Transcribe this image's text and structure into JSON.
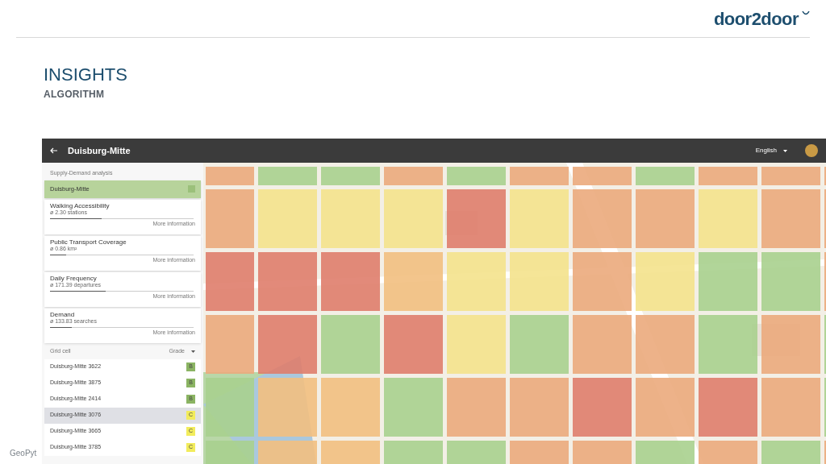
{
  "slide": {
    "logo": "door2door",
    "title": "INSIGHTS",
    "subtitle": "ALGORITHM",
    "footer": "GeoPyt"
  },
  "app": {
    "title": "Duisburg-Mitte",
    "language": "English"
  },
  "sidebar": {
    "section_label": "Supply-Demand analysis",
    "area": {
      "name": "Duisburg-Mitte",
      "selected": true
    },
    "metrics": [
      {
        "title": "Walking Accessibility",
        "value": "ø 2.30 stations",
        "level": 0.36,
        "link": "More information"
      },
      {
        "title": "Public Transport Coverage",
        "value": "ø 0.86 km²",
        "level": 0.11,
        "link": "More information"
      },
      {
        "title": "Daily Frequency",
        "value": "ø 171.39 departures",
        "level": 0.39,
        "link": "More information"
      },
      {
        "title": "Demand",
        "value": "ø 133.83 searches",
        "level": 0.15,
        "link": "More information"
      }
    ],
    "grid_list": {
      "columns": [
        "Grid cell",
        "Grade"
      ],
      "rows": [
        {
          "name": "Duisburg-Mitte 3622",
          "grade": "B",
          "color": "#8bb463",
          "selected": false
        },
        {
          "name": "Duisburg-Mitte 3875",
          "grade": "B",
          "color": "#8bb463",
          "selected": false
        },
        {
          "name": "Duisburg-Mitte 2414",
          "grade": "B",
          "color": "#8bb463",
          "selected": false
        },
        {
          "name": "Duisburg-Mitte 3076",
          "grade": "C",
          "color": "#f2ec5c",
          "selected": true
        },
        {
          "name": "Duisburg-Mitte 3665",
          "grade": "C",
          "color": "#f2ec5c",
          "selected": false
        },
        {
          "name": "Duisburg-Mitte 3785",
          "grade": "C",
          "color": "#f2ec5c",
          "selected": false
        }
      ]
    }
  },
  "heatmap": {
    "rows": [
      {
        "cells": [
          {
            "color": "#ebaa7c"
          },
          {
            "color": "#a9d08e"
          },
          {
            "color": "#a9d08e"
          },
          {
            "color": "#ebaa7c"
          },
          {
            "color": "#a9d08e"
          },
          {
            "color": "#ebaa7c"
          },
          {
            "color": "#ebaa7c"
          },
          {
            "color": "#a9d08e"
          },
          {
            "color": "#ebaa7c"
          },
          {
            "color": "#ebaa7c"
          },
          {
            "color": "#ebaa7c"
          }
        ]
      },
      {
        "cells": [
          {
            "color": "#ebaa7c"
          },
          {
            "color": "#f4e28c"
          },
          {
            "color": "#f4e28c"
          },
          {
            "color": "#f4e28c"
          },
          {
            "color": "#df7d6c"
          },
          {
            "color": "#f4e28c"
          },
          {
            "color": "#ebaa7c"
          },
          {
            "color": "#ebaa7c"
          },
          {
            "color": "#f4e28c"
          },
          {
            "color": "#ebaa7c"
          },
          {
            "color": "#ebaa7c"
          }
        ]
      },
      {
        "cells": [
          {
            "color": "#df7d6c"
          },
          {
            "color": "#df7d6c"
          },
          {
            "color": "#df7d6c"
          },
          {
            "color": "#f2bf80"
          },
          {
            "color": "#f4e28c"
          },
          {
            "color": "#f4e28c"
          },
          {
            "color": "#ebaa7c"
          },
          {
            "color": "#f4e28c"
          },
          {
            "color": "#a9d08e"
          },
          {
            "color": "#a9d08e"
          },
          {
            "color": "#ebaa7c"
          }
        ]
      },
      {
        "cells": [
          {
            "color": "#ebaa7c"
          },
          {
            "color": "#df7d6c"
          },
          {
            "color": "#a9d08e"
          },
          {
            "color": "#df7d6c"
          },
          {
            "color": "#f4e28c"
          },
          {
            "color": "#a9d08e"
          },
          {
            "color": "#ebaa7c"
          },
          {
            "color": "#ebaa7c"
          },
          {
            "color": "#a9d08e"
          },
          {
            "color": "#ebaa7c"
          },
          {
            "color": "#a9d08e"
          }
        ]
      },
      {
        "cells": [
          {
            "color": "#a9d08e"
          },
          {
            "color": "#f2bf80"
          },
          {
            "color": "#f2bf80"
          },
          {
            "color": "#a9d08e"
          },
          {
            "color": "#ebaa7c"
          },
          {
            "color": "#ebaa7c"
          },
          {
            "color": "#df7d6c"
          },
          {
            "color": "#ebaa7c"
          },
          {
            "color": "#df7d6c"
          },
          {
            "color": "#ebaa7c"
          },
          {
            "color": "#a9d08e"
          }
        ]
      },
      {
        "cells": [
          {
            "color": "#a9d08e"
          },
          {
            "color": "#f2bf80"
          },
          {
            "color": "#f2bf80"
          },
          {
            "color": "#a9d08e"
          },
          {
            "color": "#a9d08e"
          },
          {
            "color": "#ebaa7c"
          },
          {
            "color": "#ebaa7c"
          },
          {
            "color": "#a9d08e"
          },
          {
            "color": "#ebaa7c"
          },
          {
            "color": "#a9d08e"
          },
          {
            "color": "#ebaa7c"
          }
        ]
      }
    ]
  }
}
